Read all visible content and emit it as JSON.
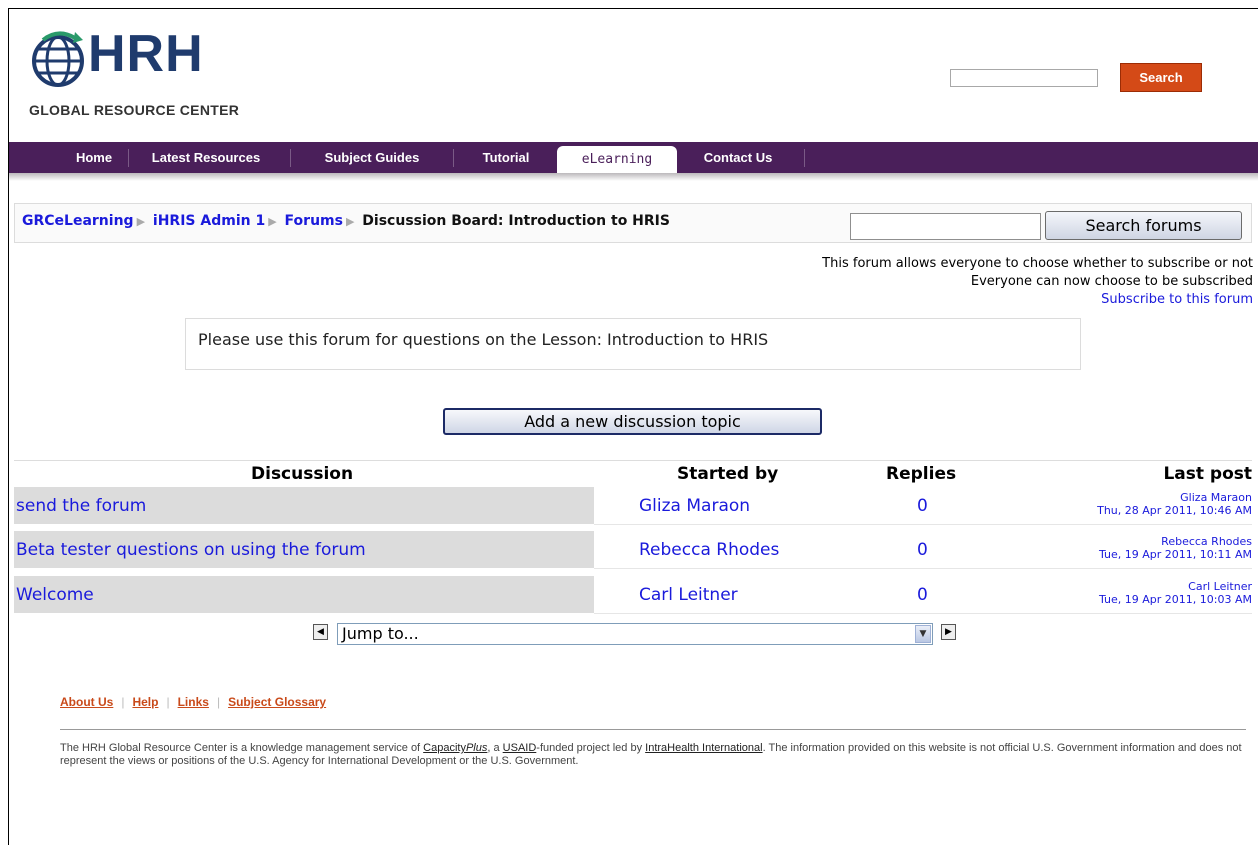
{
  "header": {
    "logo_title": "HRH",
    "logo_subtitle": "GLOBAL RESOURCE CENTER",
    "search_button": "Search"
  },
  "nav": {
    "items": [
      {
        "label": "Home"
      },
      {
        "label": "Latest Resources"
      },
      {
        "label": "Subject Guides"
      },
      {
        "label": "Tutorial"
      },
      {
        "label": "eLearning"
      },
      {
        "label": "Contact Us"
      }
    ]
  },
  "breadcrumb": {
    "items": [
      "GRCeLearning",
      "iHRIS Admin 1",
      "Forums"
    ],
    "current": "Discussion Board: Introduction to HRIS"
  },
  "forum_search": {
    "button": "Search forums"
  },
  "subscription": {
    "line1": "This forum allows everyone to choose whether to subscribe or not",
    "line2": "Everyone can now choose to be subscribed",
    "link": "Subscribe to this forum"
  },
  "intro": "Please use this forum for questions on the Lesson: Introduction to HRIS",
  "add_topic_button": "Add a new discussion topic",
  "table": {
    "headers": {
      "discussion": "Discussion",
      "started_by": "Started by",
      "replies": "Replies",
      "last_post": "Last post"
    },
    "rows": [
      {
        "topic": "send the forum",
        "author": "Gliza Maraon",
        "replies": "0",
        "last_by": "Gliza Maraon",
        "last_date": "Thu, 28 Apr 2011, 10:46 AM"
      },
      {
        "topic": "Beta tester questions on using the forum",
        "author": "Rebecca Rhodes",
        "replies": "0",
        "last_by": "Rebecca Rhodes",
        "last_date": "Tue, 19 Apr 2011, 10:11 AM"
      },
      {
        "topic": "Welcome",
        "author": "Carl Leitner",
        "replies": "0",
        "last_by": "Carl Leitner",
        "last_date": "Tue, 19 Apr 2011, 10:03 AM"
      }
    ]
  },
  "jump": {
    "selected": "Jump to..."
  },
  "footer": {
    "links": [
      "About Us",
      "Help",
      "Links",
      "Subject Glossary"
    ],
    "text_part1": "The HRH Global Resource Center is a knowledge management service of ",
    "link_capacity": "Capacity",
    "link_capacity_plus": "Plus",
    "text_part2": ", a ",
    "link_usaid": "USAID",
    "text_part3": "-funded project led by ",
    "link_intrahealth": "IntraHealth International",
    "text_part4": ". The information provided on this website is not official U.S. Government information and does not represent the views or positions of the U.S. Agency for International Development or the U.S. Government."
  }
}
